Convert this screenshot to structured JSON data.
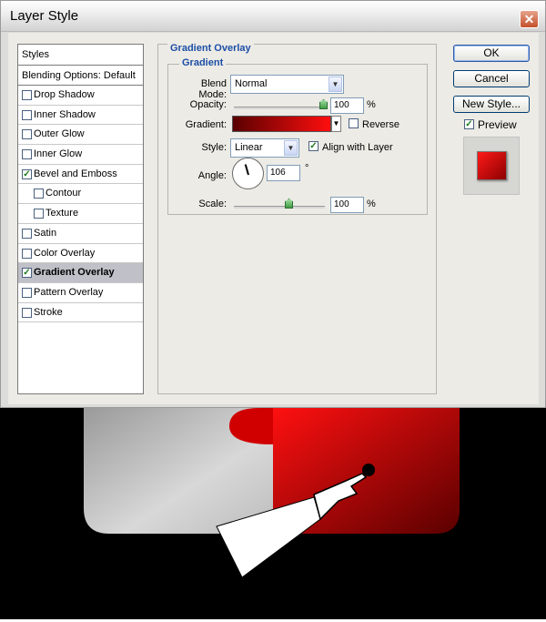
{
  "window": {
    "title": "Layer Style",
    "close_label": "✕"
  },
  "styles_panel": {
    "header": "Styles",
    "blending": "Blending Options: Default",
    "items": [
      {
        "label": "Drop Shadow",
        "checked": false,
        "indent": false,
        "selected": false
      },
      {
        "label": "Inner Shadow",
        "checked": false,
        "indent": false,
        "selected": false
      },
      {
        "label": "Outer Glow",
        "checked": false,
        "indent": false,
        "selected": false
      },
      {
        "label": "Inner Glow",
        "checked": false,
        "indent": false,
        "selected": false
      },
      {
        "label": "Bevel and Emboss",
        "checked": true,
        "indent": false,
        "selected": false
      },
      {
        "label": "Contour",
        "checked": false,
        "indent": true,
        "selected": false
      },
      {
        "label": "Texture",
        "checked": false,
        "indent": true,
        "selected": false
      },
      {
        "label": "Satin",
        "checked": false,
        "indent": false,
        "selected": false
      },
      {
        "label": "Color Overlay",
        "checked": false,
        "indent": false,
        "selected": false
      },
      {
        "label": "Gradient Overlay",
        "checked": true,
        "indent": false,
        "selected": true
      },
      {
        "label": "Pattern Overlay",
        "checked": false,
        "indent": false,
        "selected": false
      },
      {
        "label": "Stroke",
        "checked": false,
        "indent": false,
        "selected": false
      }
    ]
  },
  "gradient_overlay": {
    "group_title": "Gradient Overlay",
    "sub_title": "Gradient",
    "blend_mode_label": "Blend Mode:",
    "blend_mode_value": "Normal",
    "opacity_label": "Opacity:",
    "opacity_value": "100",
    "opacity_unit": "%",
    "gradient_label": "Gradient:",
    "reverse_label": "Reverse",
    "reverse_checked": false,
    "style_label": "Style:",
    "style_value": "Linear",
    "align_label": "Align with Layer",
    "align_checked": true,
    "angle_label": "Angle:",
    "angle_value": "106",
    "angle_unit": "°",
    "scale_label": "Scale:",
    "scale_value": "100",
    "scale_unit": "%",
    "gradient_colors": [
      "#5a0000",
      "#ff0e0e"
    ]
  },
  "buttons": {
    "ok": "OK",
    "cancel": "Cancel",
    "new_style": "New Style..."
  },
  "preview": {
    "label": "Preview",
    "checked": true
  },
  "colors": {
    "accent_blue": "#1c4ea7",
    "swatch_red": "#e00000"
  }
}
